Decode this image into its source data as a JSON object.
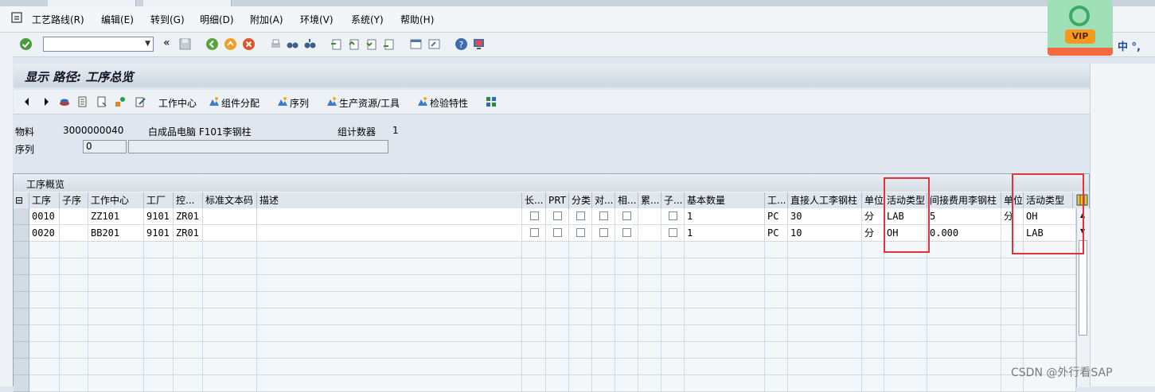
{
  "menu": {
    "items": [
      "工艺路线(R)",
      "编辑(E)",
      "转到(G)",
      "明细(D)",
      "附加(A)",
      "环境(V)",
      "系统(Y)",
      "帮助(H)"
    ]
  },
  "toolbar": {
    "back_symbol": "«",
    "language": "中 °,"
  },
  "vip": {
    "label": "VIP"
  },
  "page": {
    "title": "显示 路径: 工序总览"
  },
  "app_toolbar": {
    "work_center": "工作中心",
    "component_alloc": "组件分配",
    "sequence": "序列",
    "prt": "生产资源/工具",
    "inspection": "检验特性"
  },
  "header": {
    "material_label": "物料",
    "material_value": "3000000040",
    "material_desc": "白成品电脑 F101李钢柱",
    "group_counter_label": "组计数器",
    "group_counter_value": "1",
    "sequence_label": "序列",
    "sequence_value": "0",
    "sequence_desc": ""
  },
  "table": {
    "title": "工序概览",
    "columns": [
      "工序",
      "子序",
      "工作中心",
      "工厂",
      "控...",
      "标准文本码",
      "描述",
      "长...",
      "PRT",
      "分类",
      "对...",
      "相...",
      "累...",
      "子...",
      "基本数量",
      "工...",
      "直接人工李钢柱",
      "单位",
      "活动类型",
      "间接费用李钢柱",
      "单位",
      "活动类型"
    ],
    "rows": [
      {
        "op": "0010",
        "sub": "",
        "wc": "ZZ101",
        "plant": "9101",
        "ctrl": "ZR01",
        "std": "",
        "desc": "",
        "qty": "1",
        "unit": "PC",
        "labor": "30",
        "labor_unit": "分",
        "act1": "LAB",
        "overhead": "5",
        "oh_unit": "分",
        "act2": "OH"
      },
      {
        "op": "0020",
        "sub": "",
        "wc": "BB201",
        "plant": "9101",
        "ctrl": "ZR01",
        "std": "",
        "desc": "",
        "qty": "1",
        "unit": "PC",
        "labor": "10",
        "labor_unit": "分",
        "act1": "OH",
        "overhead": "0.000",
        "oh_unit": "",
        "act2": "LAB"
      }
    ]
  },
  "watermark": "CSDN @外行看SAP"
}
